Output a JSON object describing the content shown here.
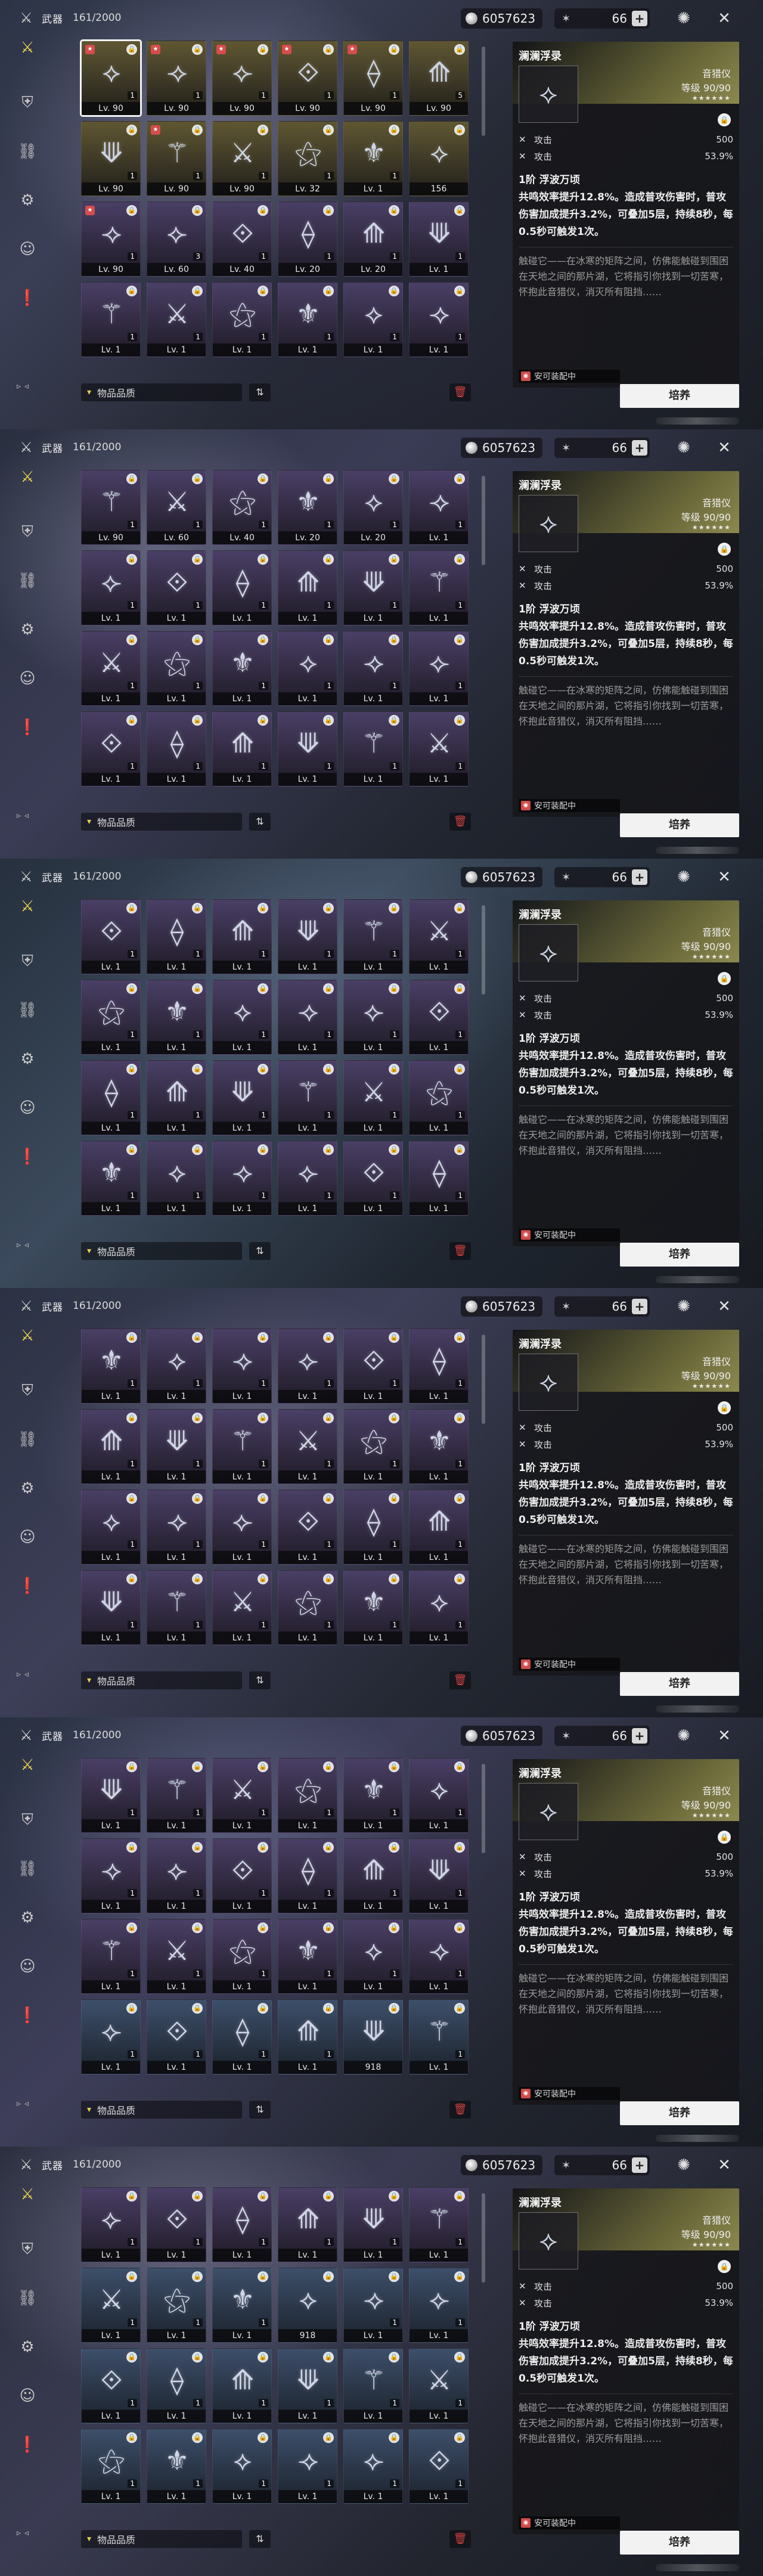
{
  "colors": {
    "accent": "#e8d24f",
    "delete": "#d34141",
    "panel_dark": "#141416"
  },
  "header": {
    "title": "武器",
    "count": "161/2000",
    "currency": "6057623",
    "stamina": "66",
    "stamina_plus": "+",
    "icons": {
      "currency": "coin-icon",
      "stamina": "star-icon",
      "top_right_1": "compass-icon",
      "top_right_2": "close-icon"
    }
  },
  "sidebar": {
    "items": [
      {
        "icon": "swords-icon",
        "active": true
      },
      {
        "icon": "armor-icon",
        "active": false
      },
      {
        "icon": "link-icon",
        "active": false
      },
      {
        "icon": "gear-icon",
        "active": false
      },
      {
        "icon": "face-icon",
        "active": false
      },
      {
        "icon": "alert-icon",
        "active": false
      }
    ]
  },
  "bottom": {
    "filter_label": "物品品质",
    "sort_icon": "sort-icon",
    "delete_icon": "trash-icon"
  },
  "detail": {
    "name": "澜澜浮录",
    "type": "音猎仪",
    "level": "等级 90/90",
    "stars": "★★★★★★",
    "stats": [
      {
        "label": "攻击",
        "value": "500"
      },
      {
        "label": "攻击",
        "value": "53.9%"
      }
    ],
    "skill_name": "1阶 浮波万顷",
    "skill_text": "共鸣效率提升12.8%。造成普攻伤害时，普攻伤害加成提升3.2%，可叠加5层，持续8秒，每0.5秒可触发1次。",
    "lore": "触碰它——在冰寒的矩阵之间，仿佛能触碰到围困在天地之间的那片湖，它将指引你找到一切苦寒，怀抱此音猎仪，消灭所有阻挡……",
    "equip_label": "安可装配中",
    "cultivate": "培养"
  },
  "panels": [
    {
      "cells": [
        {
          "lv": "Lv. 90",
          "q": "gold",
          "qty": "1",
          "sel": true,
          "badge": true
        },
        {
          "lv": "Lv. 90",
          "q": "gold",
          "qty": "1",
          "badge": true
        },
        {
          "lv": "Lv. 90",
          "q": "gold",
          "qty": "1",
          "badge": true
        },
        {
          "lv": "Lv. 90",
          "q": "gold",
          "qty": "1",
          "badge": true
        },
        {
          "lv": "Lv. 90",
          "q": "gold",
          "qty": "1",
          "badge": true
        },
        {
          "lv": "Lv. 90",
          "q": "gold",
          "qty": "5"
        },
        {
          "lv": "Lv. 90",
          "q": "gold",
          "qty": "1"
        },
        {
          "lv": "Lv. 90",
          "q": "gold",
          "qty": "1",
          "badge": true
        },
        {
          "lv": "Lv. 90",
          "q": "gold",
          "qty": "1"
        },
        {
          "lv": "Lv. 32",
          "q": "gold",
          "qty": "1"
        },
        {
          "lv": "Lv. 1",
          "q": "gold",
          "qty": "1"
        },
        {
          "lv": "156",
          "q": "gold",
          "qty": ""
        },
        {
          "lv": "Lv. 90",
          "q": "purple",
          "qty": "1",
          "badge": true
        },
        {
          "lv": "Lv. 60",
          "q": "purple",
          "qty": "3"
        },
        {
          "lv": "Lv. 40",
          "q": "purple",
          "qty": "1"
        },
        {
          "lv": "Lv. 20",
          "q": "purple",
          "qty": "1"
        },
        {
          "lv": "Lv. 20",
          "q": "purple",
          "qty": "1"
        },
        {
          "lv": "Lv. 1",
          "q": "purple",
          "qty": "1"
        },
        {
          "lv": "Lv. 1",
          "q": "purple",
          "qty": "1"
        },
        {
          "lv": "Lv. 1",
          "q": "purple",
          "qty": "1"
        },
        {
          "lv": "Lv. 1",
          "q": "purple",
          "qty": "1"
        },
        {
          "lv": "Lv. 1",
          "q": "purple",
          "qty": "1"
        },
        {
          "lv": "Lv. 1",
          "q": "purple",
          "qty": "1"
        },
        {
          "lv": "Lv. 1",
          "q": "purple",
          "qty": "1"
        }
      ]
    },
    {
      "cells": [
        {
          "lv": "Lv. 90",
          "q": "purple",
          "qty": "1"
        },
        {
          "lv": "Lv. 60",
          "q": "purple",
          "qty": "1"
        },
        {
          "lv": "Lv. 40",
          "q": "purple",
          "qty": "1"
        },
        {
          "lv": "Lv. 20",
          "q": "purple",
          "qty": "1"
        },
        {
          "lv": "Lv. 20",
          "q": "purple",
          "qty": "1"
        },
        {
          "lv": "Lv. 1",
          "q": "purple",
          "qty": "1"
        },
        {
          "lv": "Lv. 1",
          "q": "purple",
          "qty": "1"
        },
        {
          "lv": "Lv. 1",
          "q": "purple",
          "qty": "1"
        },
        {
          "lv": "Lv. 1",
          "q": "purple",
          "qty": "1"
        },
        {
          "lv": "Lv. 1",
          "q": "purple",
          "qty": "1"
        },
        {
          "lv": "Lv. 1",
          "q": "purple",
          "qty": "1"
        },
        {
          "lv": "Lv. 1",
          "q": "purple",
          "qty": "1"
        },
        {
          "lv": "Lv. 1",
          "q": "purple",
          "qty": "1"
        },
        {
          "lv": "Lv. 1",
          "q": "purple",
          "qty": "1"
        },
        {
          "lv": "Lv. 1",
          "q": "purple",
          "qty": "1"
        },
        {
          "lv": "Lv. 1",
          "q": "purple",
          "qty": "1"
        },
        {
          "lv": "Lv. 1",
          "q": "purple",
          "qty": "1"
        },
        {
          "lv": "Lv. 1",
          "q": "purple",
          "qty": "1"
        },
        {
          "lv": "Lv. 1",
          "q": "purple",
          "qty": "1"
        },
        {
          "lv": "Lv. 1",
          "q": "purple",
          "qty": "1"
        },
        {
          "lv": "Lv. 1",
          "q": "purple",
          "qty": "1"
        },
        {
          "lv": "Lv. 1",
          "q": "purple",
          "qty": "1"
        },
        {
          "lv": "Lv. 1",
          "q": "purple",
          "qty": "1"
        },
        {
          "lv": "Lv. 1",
          "q": "purple",
          "qty": "1"
        }
      ]
    },
    {
      "cells": [
        {
          "lv": "Lv. 1",
          "q": "purple",
          "qty": "1"
        },
        {
          "lv": "Lv. 1",
          "q": "purple",
          "qty": "1"
        },
        {
          "lv": "Lv. 1",
          "q": "purple",
          "qty": "1"
        },
        {
          "lv": "Lv. 1",
          "q": "purple",
          "qty": "1"
        },
        {
          "lv": "Lv. 1",
          "q": "purple",
          "qty": "1"
        },
        {
          "lv": "Lv. 1",
          "q": "purple",
          "qty": "1"
        },
        {
          "lv": "Lv. 1",
          "q": "purple",
          "qty": "1"
        },
        {
          "lv": "Lv. 1",
          "q": "purple",
          "qty": "1"
        },
        {
          "lv": "Lv. 1",
          "q": "purple",
          "qty": "1"
        },
        {
          "lv": "Lv. 1",
          "q": "purple",
          "qty": "1"
        },
        {
          "lv": "Lv. 1",
          "q": "purple",
          "qty": "1"
        },
        {
          "lv": "Lv. 1",
          "q": "purple",
          "qty": "1"
        },
        {
          "lv": "Lv. 1",
          "q": "purple",
          "qty": "1"
        },
        {
          "lv": "Lv. 1",
          "q": "purple",
          "qty": "1"
        },
        {
          "lv": "Lv. 1",
          "q": "purple",
          "qty": "1"
        },
        {
          "lv": "Lv. 1",
          "q": "purple",
          "qty": "1"
        },
        {
          "lv": "Lv. 1",
          "q": "purple",
          "qty": "1"
        },
        {
          "lv": "Lv. 1",
          "q": "purple",
          "qty": "1"
        },
        {
          "lv": "Lv. 1",
          "q": "purple",
          "qty": "1"
        },
        {
          "lv": "Lv. 1",
          "q": "purple",
          "qty": "1"
        },
        {
          "lv": "Lv. 1",
          "q": "purple",
          "qty": "1"
        },
        {
          "lv": "Lv. 1",
          "q": "purple",
          "qty": "1"
        },
        {
          "lv": "Lv. 1",
          "q": "purple",
          "qty": "1"
        },
        {
          "lv": "Lv. 1",
          "q": "purple",
          "qty": "1"
        }
      ]
    },
    {
      "cells": [
        {
          "lv": "Lv. 1",
          "q": "purple",
          "qty": "1"
        },
        {
          "lv": "Lv. 1",
          "q": "purple",
          "qty": "1"
        },
        {
          "lv": "Lv. 1",
          "q": "purple",
          "qty": "1"
        },
        {
          "lv": "Lv. 1",
          "q": "purple",
          "qty": "1"
        },
        {
          "lv": "Lv. 1",
          "q": "purple",
          "qty": "1"
        },
        {
          "lv": "Lv. 1",
          "q": "purple",
          "qty": "1"
        },
        {
          "lv": "Lv. 1",
          "q": "purple",
          "qty": "1"
        },
        {
          "lv": "Lv. 1",
          "q": "purple",
          "qty": "1"
        },
        {
          "lv": "Lv. 1",
          "q": "purple",
          "qty": "1"
        },
        {
          "lv": "Lv. 1",
          "q": "purple",
          "qty": "1"
        },
        {
          "lv": "Lv. 1",
          "q": "purple",
          "qty": "1"
        },
        {
          "lv": "Lv. 1",
          "q": "purple",
          "qty": "1"
        },
        {
          "lv": "Lv. 1",
          "q": "purple",
          "qty": "1"
        },
        {
          "lv": "Lv. 1",
          "q": "purple",
          "qty": "1"
        },
        {
          "lv": "Lv. 1",
          "q": "purple",
          "qty": "1"
        },
        {
          "lv": "Lv. 1",
          "q": "purple",
          "qty": "1"
        },
        {
          "lv": "Lv. 1",
          "q": "purple",
          "qty": "1"
        },
        {
          "lv": "Lv. 1",
          "q": "purple",
          "qty": "1"
        },
        {
          "lv": "Lv. 1",
          "q": "purple",
          "qty": "1"
        },
        {
          "lv": "Lv. 1",
          "q": "purple",
          "qty": "1"
        },
        {
          "lv": "Lv. 1",
          "q": "purple",
          "qty": "1"
        },
        {
          "lv": "Lv. 1",
          "q": "purple",
          "qty": "1"
        },
        {
          "lv": "Lv. 1",
          "q": "purple",
          "qty": "1"
        },
        {
          "lv": "Lv. 1",
          "q": "purple",
          "qty": "1"
        }
      ]
    },
    {
      "cells": [
        {
          "lv": "Lv. 1",
          "q": "purple",
          "qty": "1"
        },
        {
          "lv": "Lv. 1",
          "q": "purple",
          "qty": "1"
        },
        {
          "lv": "Lv. 1",
          "q": "purple",
          "qty": "1"
        },
        {
          "lv": "Lv. 1",
          "q": "purple",
          "qty": "1"
        },
        {
          "lv": "Lv. 1",
          "q": "purple",
          "qty": "1"
        },
        {
          "lv": "Lv. 1",
          "q": "purple",
          "qty": "1"
        },
        {
          "lv": "Lv. 1",
          "q": "purple",
          "qty": "1"
        },
        {
          "lv": "Lv. 1",
          "q": "purple",
          "qty": "1"
        },
        {
          "lv": "Lv. 1",
          "q": "purple",
          "qty": "1"
        },
        {
          "lv": "Lv. 1",
          "q": "purple",
          "qty": "1"
        },
        {
          "lv": "Lv. 1",
          "q": "purple",
          "qty": "1"
        },
        {
          "lv": "Lv. 1",
          "q": "purple",
          "qty": "1"
        },
        {
          "lv": "Lv. 1",
          "q": "purple",
          "qty": "1"
        },
        {
          "lv": "Lv. 1",
          "q": "purple",
          "qty": "1"
        },
        {
          "lv": "Lv. 1",
          "q": "purple",
          "qty": "1"
        },
        {
          "lv": "Lv. 1",
          "q": "purple",
          "qty": "1"
        },
        {
          "lv": "Lv. 1",
          "q": "purple",
          "qty": "1"
        },
        {
          "lv": "Lv. 1",
          "q": "purple",
          "qty": "1"
        },
        {
          "lv": "Lv. 1",
          "q": "blue",
          "qty": "1"
        },
        {
          "lv": "Lv. 1",
          "q": "blue",
          "qty": "1"
        },
        {
          "lv": "Lv. 1",
          "q": "blue",
          "qty": "1"
        },
        {
          "lv": "Lv. 1",
          "q": "blue",
          "qty": "1"
        },
        {
          "lv": "918",
          "q": "blue",
          "qty": ""
        },
        {
          "lv": "Lv. 1",
          "q": "blue",
          "qty": "1"
        }
      ]
    },
    {
      "cells": [
        {
          "lv": "Lv. 1",
          "q": "purple",
          "qty": "1"
        },
        {
          "lv": "Lv. 1",
          "q": "purple",
          "qty": "1"
        },
        {
          "lv": "Lv. 1",
          "q": "purple",
          "qty": "1"
        },
        {
          "lv": "Lv. 1",
          "q": "purple",
          "qty": "1"
        },
        {
          "lv": "Lv. 1",
          "q": "purple",
          "qty": "1"
        },
        {
          "lv": "Lv. 1",
          "q": "purple",
          "qty": "1"
        },
        {
          "lv": "Lv. 1",
          "q": "blue",
          "qty": "1"
        },
        {
          "lv": "Lv. 1",
          "q": "blue",
          "qty": "1"
        },
        {
          "lv": "Lv. 1",
          "q": "blue",
          "qty": "1"
        },
        {
          "lv": "918",
          "q": "blue",
          "qty": ""
        },
        {
          "lv": "Lv. 1",
          "q": "blue",
          "qty": "1"
        },
        {
          "lv": "Lv. 1",
          "q": "blue",
          "qty": "1"
        },
        {
          "lv": "Lv. 1",
          "q": "blue",
          "qty": "1"
        },
        {
          "lv": "Lv. 1",
          "q": "blue",
          "qty": "1"
        },
        {
          "lv": "Lv. 1",
          "q": "blue",
          "qty": "1"
        },
        {
          "lv": "Lv. 1",
          "q": "blue",
          "qty": "1"
        },
        {
          "lv": "Lv. 1",
          "q": "blue",
          "qty": "1"
        },
        {
          "lv": "Lv. 1",
          "q": "blue",
          "qty": "1"
        },
        {
          "lv": "Lv. 1",
          "q": "blue",
          "qty": "1"
        },
        {
          "lv": "Lv. 1",
          "q": "blue",
          "qty": "1"
        },
        {
          "lv": "Lv. 1",
          "q": "blue",
          "qty": "1"
        },
        {
          "lv": "Lv. 1",
          "q": "blue",
          "qty": "1"
        },
        {
          "lv": "Lv. 1",
          "q": "blue",
          "qty": "1"
        },
        {
          "lv": "Lv. 1",
          "q": "blue",
          "qty": "1"
        }
      ]
    }
  ]
}
